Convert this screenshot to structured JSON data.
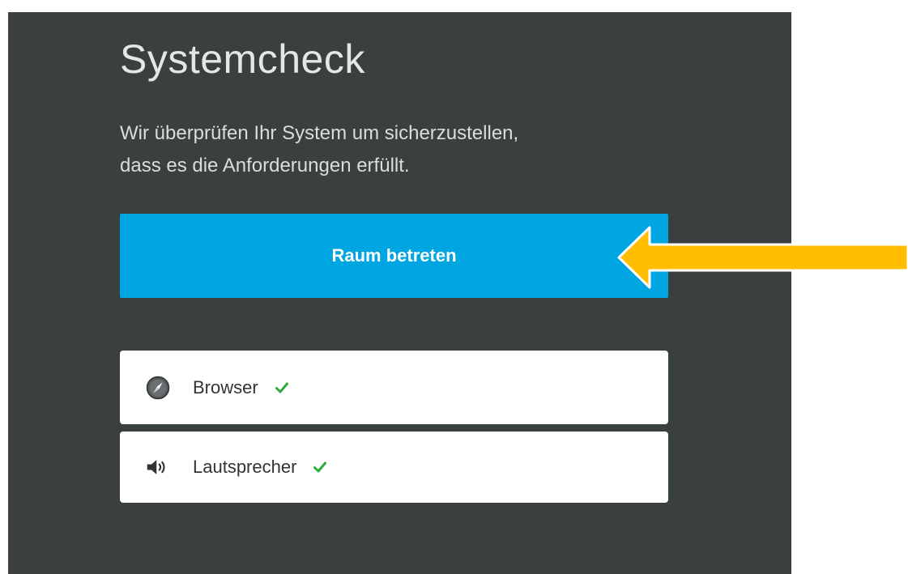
{
  "page": {
    "title": "Systemcheck",
    "subtitle_line1": "Wir überprüfen Ihr System um sicherzustellen,",
    "subtitle_line2": "dass es die Anforderungen erfüllt.",
    "enter_button_label": "Raum betreten"
  },
  "checks": [
    {
      "label": "Browser",
      "icon": "compass-icon",
      "status": "ok"
    },
    {
      "label": "Lautsprecher",
      "icon": "speaker-icon",
      "status": "ok"
    }
  ],
  "colors": {
    "panel_bg": "#3a4040",
    "accent": "#00a6e2",
    "check_ok": "#2eaa3f",
    "arrow": "#ffbf00"
  }
}
